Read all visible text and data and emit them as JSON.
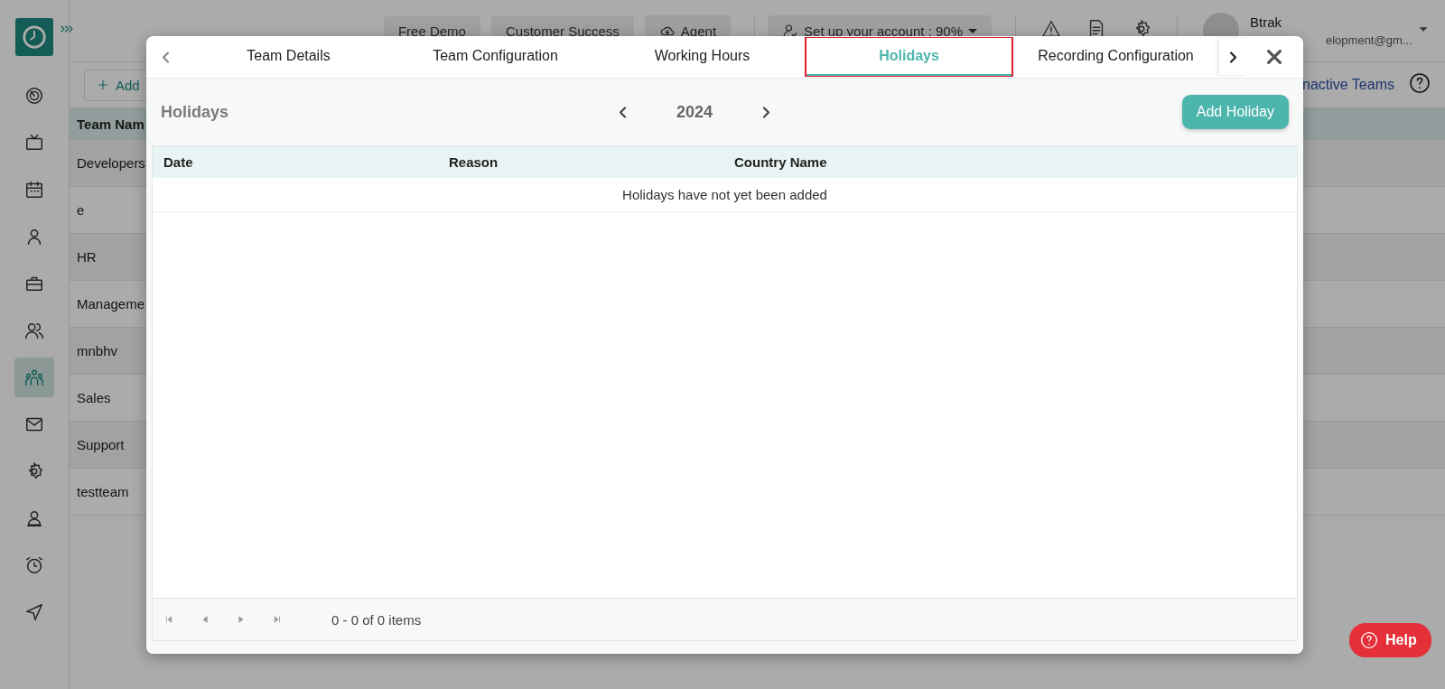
{
  "sidebar": {
    "items": [
      {
        "selected": false
      },
      {
        "selected": false
      },
      {
        "selected": false
      },
      {
        "selected": false
      },
      {
        "selected": false
      },
      {
        "selected": false
      },
      {
        "selected": true
      },
      {
        "selected": false
      },
      {
        "selected": false
      },
      {
        "selected": false
      },
      {
        "selected": false
      },
      {
        "selected": false
      }
    ]
  },
  "header": {
    "buttons": [
      "Free Demo",
      "Customer Success",
      "Agent"
    ],
    "setup": "Set up your account : 90%",
    "user": {
      "name": "Btrak",
      "email": "elopment@gm..."
    }
  },
  "toolbar": {
    "add": "Add",
    "inactive": "nactive Teams"
  },
  "teams": {
    "header": "Team Nam",
    "rows": [
      "Developers",
      "e",
      "HR",
      "Manageme",
      "mnbhv",
      "Sales",
      "Support",
      "testteam"
    ]
  },
  "dialog": {
    "tabs": [
      {
        "label": "Team Details",
        "selected": false
      },
      {
        "label": "Team Configuration",
        "selected": false
      },
      {
        "label": "Working Hours",
        "selected": false
      },
      {
        "label": "Holidays",
        "selected": true
      },
      {
        "label": "Recording Configuration",
        "selected": false
      }
    ],
    "title": "Holidays",
    "year": "2024",
    "add_button": "Add Holiday",
    "columns": [
      "Date",
      "Reason",
      "Country Name"
    ],
    "empty": "Holidays have not yet been added",
    "pager": "0 - 0 of 0 items"
  },
  "help": "Help"
}
